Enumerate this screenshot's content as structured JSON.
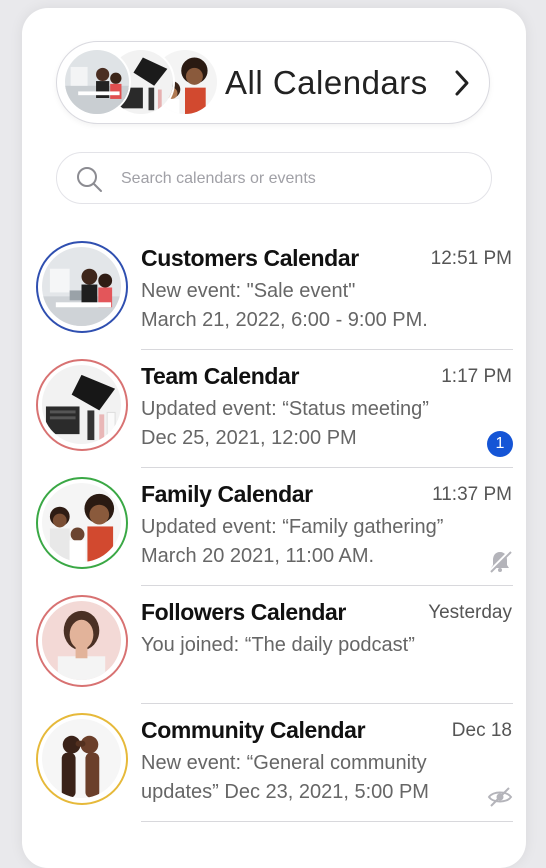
{
  "header": {
    "title": "All Calendars",
    "avatars": [
      "office-meeting",
      "desk-workspace",
      "family-photo"
    ]
  },
  "search": {
    "placeholder": "Search calendars or events"
  },
  "calendars": [
    {
      "name": "Customers Calendar",
      "time": "12:51 PM",
      "line1": "New event: \"Sale event\"",
      "line2": "March 21, 2022, 6:00 - 9:00 PM.",
      "ring_color": "#2f4fb0",
      "indicator": null
    },
    {
      "name": "Team Calendar",
      "time": "1:17 PM",
      "line1": "Updated event: “Status meeting”",
      "line2": "Dec 25, 2021, 12:00 PM",
      "ring_color": "#d87272",
      "indicator": "unread-badge",
      "badge": "1",
      "badge_color": "#1555d6"
    },
    {
      "name": "Family Calendar",
      "time": "11:37 PM",
      "line1": "Updated event: “Family gathering”",
      "line2": "March 20 2021, 11:00 AM.",
      "ring_color": "#3aa845",
      "indicator": "muted-bell-icon"
    },
    {
      "name": "Followers Calendar",
      "time": "Yesterday",
      "line1": "You joined: “The daily podcast”",
      "line2": "",
      "ring_color": "#d87272",
      "indicator": null
    },
    {
      "name": "Community Calendar",
      "time": "Dec 18",
      "line1": "New event: “General community",
      "line2": "updates” Dec 23, 2021, 5:00 PM",
      "ring_color": "#e6b93a",
      "indicator": "hidden-eye-icon"
    }
  ]
}
